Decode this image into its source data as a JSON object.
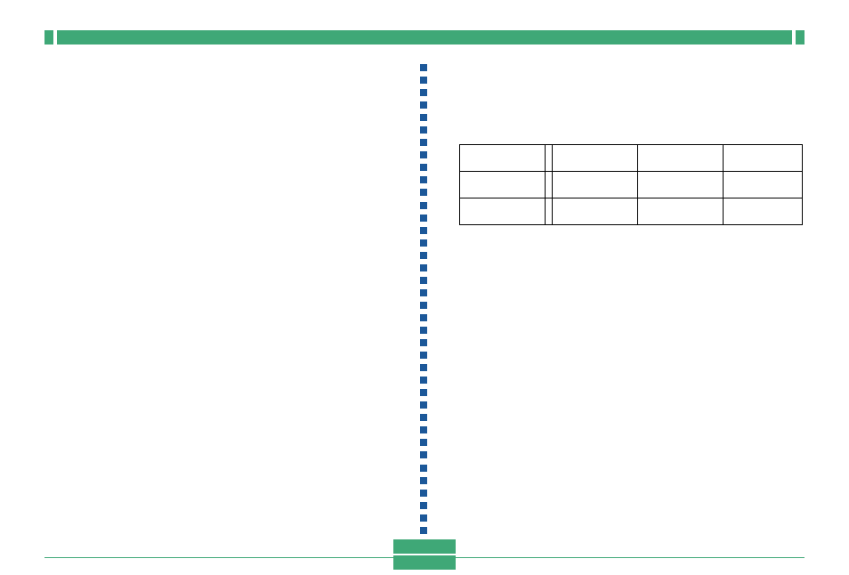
{
  "colors": {
    "green": "#3fa877",
    "blue": "#1c5899",
    "border": "#000000"
  },
  "table": {
    "rows": 3,
    "cols": 5,
    "cells": [
      [
        "",
        "",
        "",
        "",
        ""
      ],
      [
        "",
        "",
        "",
        "",
        ""
      ],
      [
        "",
        "",
        "",
        "",
        ""
      ]
    ]
  }
}
